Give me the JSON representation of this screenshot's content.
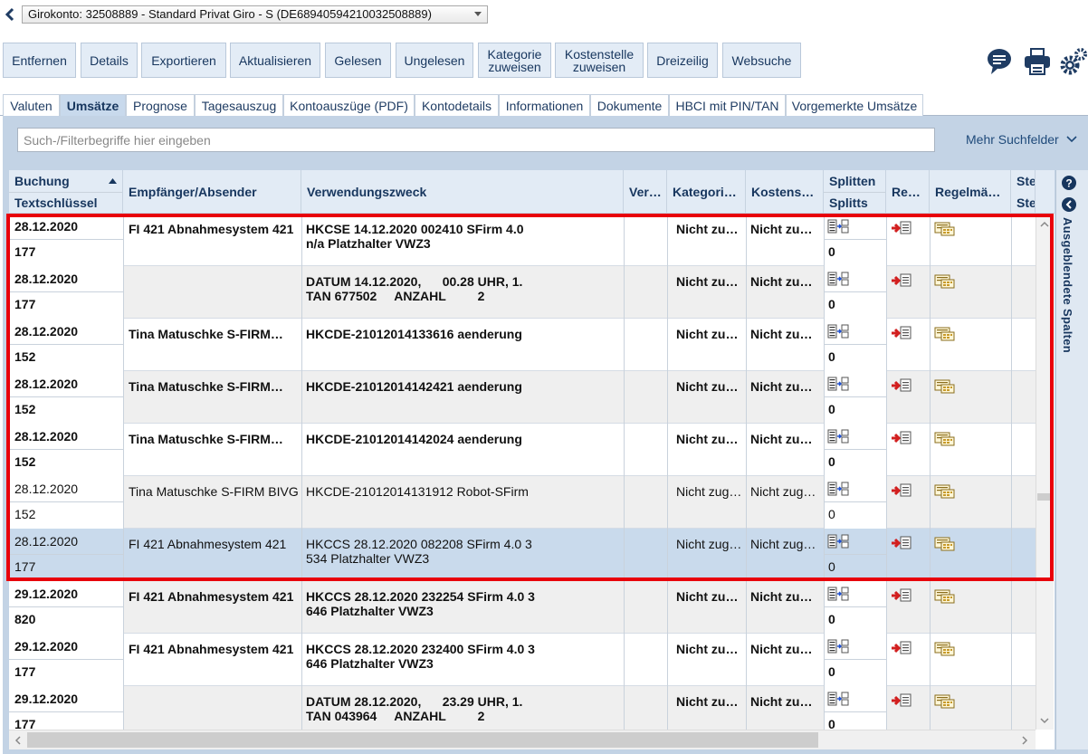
{
  "account": {
    "selected": "Girokonto: 32508889 - Standard Privat Giro - S (DE68940594210032508889)"
  },
  "toolbar": {
    "buttons": [
      {
        "label": "Entfernen"
      },
      {
        "label": "Details"
      },
      {
        "label": "Exportieren"
      },
      {
        "label": "Aktualisieren"
      },
      {
        "label": "Gelesen"
      },
      {
        "label": "Ungelesen"
      },
      {
        "label_line1": "Kategorie",
        "label_line2": "zuweisen"
      },
      {
        "label_line1": "Kostenstelle",
        "label_line2": "zuweisen"
      },
      {
        "label": "Dreizeilig"
      },
      {
        "label": "Websuche"
      }
    ],
    "icons": [
      "chat-icon",
      "printer-icon",
      "settings-gears-icon"
    ]
  },
  "tabs": [
    {
      "label": "Valuten"
    },
    {
      "label": "Umsätze",
      "active": true
    },
    {
      "label": "Prognose"
    },
    {
      "label": "Tagesauszug"
    },
    {
      "label": "Kontoauszüge (PDF)"
    },
    {
      "label": "Kontodetails"
    },
    {
      "label": "Informationen"
    },
    {
      "label": "Dokumente"
    },
    {
      "label": "HBCI mit PIN/TAN"
    },
    {
      "label": "Vorgemerkte Umsätze"
    }
  ],
  "search": {
    "placeholder": "Such-/Filterbegriffe hier eingeben",
    "more_fields": "Mehr Suchfelder"
  },
  "columns": {
    "buchung": "Buchung",
    "textschluessel": "Textschlüssel",
    "empfaenger": "Empfänger/Absender",
    "verwendungszweck": "Verwendungszweck",
    "ver": "Ver…",
    "kategorie": "Kategori…",
    "kostenstelle": "Kostens…",
    "splitten": "Splitten",
    "splitts": "Splitts",
    "re": "Re…",
    "regelmaessig": "Regelmä…",
    "ste1": "Ste",
    "ste2": "Ste"
  },
  "side_panel": {
    "label": "Ausgeblendete Spalten"
  },
  "rows": [
    {
      "date": "28.12.2020",
      "code": "177",
      "recipient": "FI 421 Abnahmesystem 421",
      "purpose1": "HKCSE 14.12.2020 002410 SFirm 4.0",
      "purpose2": "n/a Platzhalter VWZ3",
      "category": "Nicht zu…",
      "cost_center": "Nicht zu…",
      "splits": "0",
      "bold": true
    },
    {
      "date": "28.12.2020",
      "code": "177",
      "recipient": "",
      "purpose1": "DATUM 14.12.2020,      00.28 UHR, 1.",
      "purpose2": "TAN 677502     ANZAHL         2",
      "category": "Nicht zu…",
      "cost_center": "Nicht zu…",
      "splits": "0",
      "bold": true
    },
    {
      "date": "28.12.2020",
      "code": "152",
      "recipient": "Tina Matuschke S-FIRM…",
      "purpose1": "HKCDE-21012014133616 aenderung",
      "purpose2": "",
      "category": "Nicht zu…",
      "cost_center": "Nicht zu…",
      "splits": "0",
      "bold": true
    },
    {
      "date": "28.12.2020",
      "code": "152",
      "recipient": "Tina Matuschke S-FIRM…",
      "purpose1": "HKCDE-21012014142421 aenderung",
      "purpose2": "",
      "category": "Nicht zu…",
      "cost_center": "Nicht zu…",
      "splits": "0",
      "bold": true
    },
    {
      "date": "28.12.2020",
      "code": "152",
      "recipient": "Tina Matuschke S-FIRM…",
      "purpose1": "HKCDE-21012014142024 aenderung",
      "purpose2": "",
      "category": "Nicht zu…",
      "cost_center": "Nicht zu…",
      "splits": "0",
      "bold": true
    },
    {
      "date": "28.12.2020",
      "code": "152",
      "recipient": "Tina Matuschke S-FIRM BIVG",
      "purpose1": "HKCDE-21012014131912 Robot-SFirm",
      "purpose2": "",
      "category": "Nicht zug…",
      "cost_center": "Nicht zug…",
      "splits": "0",
      "bold": false
    },
    {
      "date": "28.12.2020",
      "code": "177",
      "recipient": "FI 421 Abnahmesystem 421",
      "purpose1": "HKCCS 28.12.2020 082208 SFirm 4.0 3",
      "purpose2": "534 Platzhalter VWZ3",
      "category": "Nicht zug…",
      "cost_center": "Nicht zug…",
      "splits": "0",
      "bold": false,
      "selected": true
    },
    {
      "date": "29.12.2020",
      "code": "820",
      "recipient": "FI 421 Abnahmesystem 421",
      "purpose1": "HKCCS 28.12.2020 232254 SFirm 4.0 3",
      "purpose2": "646 Platzhalter VWZ3",
      "category": "Nicht zu…",
      "cost_center": "Nicht zu…",
      "splits": "0",
      "bold": true
    },
    {
      "date": "29.12.2020",
      "code": "177",
      "recipient": "FI 421 Abnahmesystem 421",
      "purpose1": "HKCCS 28.12.2020 232400 SFirm 4.0 3",
      "purpose2": "646 Platzhalter VWZ3",
      "category": "Nicht zu…",
      "cost_center": "Nicht zu…",
      "splits": "0",
      "bold": true
    },
    {
      "date": "29.12.2020",
      "code": "177",
      "recipient": "",
      "purpose1": "DATUM 28.12.2020,      23.29 UHR, 1.",
      "purpose2": "TAN 043964     ANZAHL         2",
      "category": "Nicht zu…",
      "cost_center": "Nicht zu…",
      "splits": "0",
      "bold": true
    }
  ]
}
